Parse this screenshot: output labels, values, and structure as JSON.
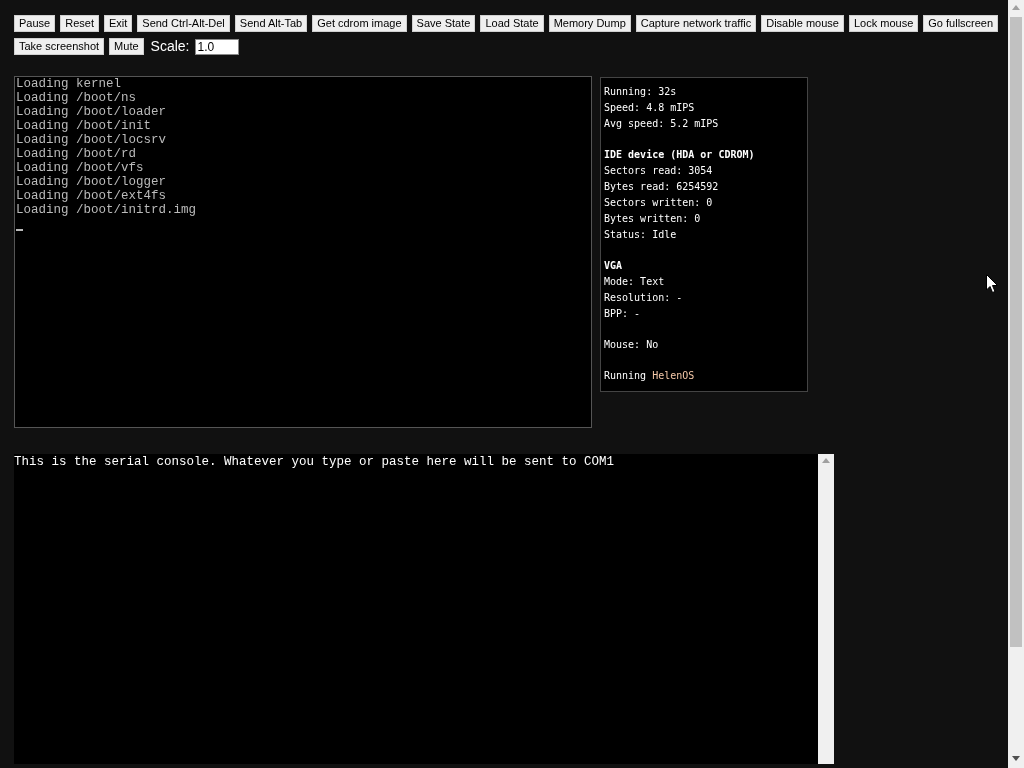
{
  "toolbar": {
    "buttons": [
      "Pause",
      "Reset",
      "Exit",
      "Send Ctrl-Alt-Del",
      "Send Alt-Tab",
      "Get cdrom image",
      "Save State",
      "Load State",
      "Memory Dump",
      "Capture network traffic",
      "Disable mouse",
      "Lock mouse",
      "Go fullscreen",
      "Take screenshot",
      "Mute"
    ],
    "scale": {
      "label": "Scale:",
      "value": "1.0"
    }
  },
  "screen": {
    "lines": [
      "Loading kernel",
      "Loading /boot/ns",
      "Loading /boot/loader",
      "Loading /boot/init",
      "Loading /boot/locsrv",
      "Loading /boot/rd",
      "Loading /boot/vfs",
      "Loading /boot/logger",
      "Loading /boot/ext4fs",
      "Loading /boot/initrd.img"
    ],
    "cursor": true
  },
  "stats": {
    "groups": [
      {
        "lines": [
          "Running: 32s",
          "Speed: 4.8 mIPS",
          "Avg speed: 5.2 mIPS"
        ]
      },
      {
        "heading": "IDE device (HDA or CDROM)",
        "lines": [
          "Sectors read: 3054",
          "Bytes read: 6254592",
          "Sectors written: 0",
          "Bytes written: 0",
          "Status: Idle"
        ]
      },
      {
        "heading": "VGA",
        "lines": [
          "Mode: Text",
          "Resolution: -",
          "BPP: -"
        ]
      },
      {
        "lines": [
          "Mouse: No"
        ]
      }
    ],
    "running_os": {
      "label": "Running",
      "name": "HelenOS"
    }
  },
  "serial_console": {
    "value": "This is the serial console. Whatever you type or paste here will be sent to COM1"
  }
}
